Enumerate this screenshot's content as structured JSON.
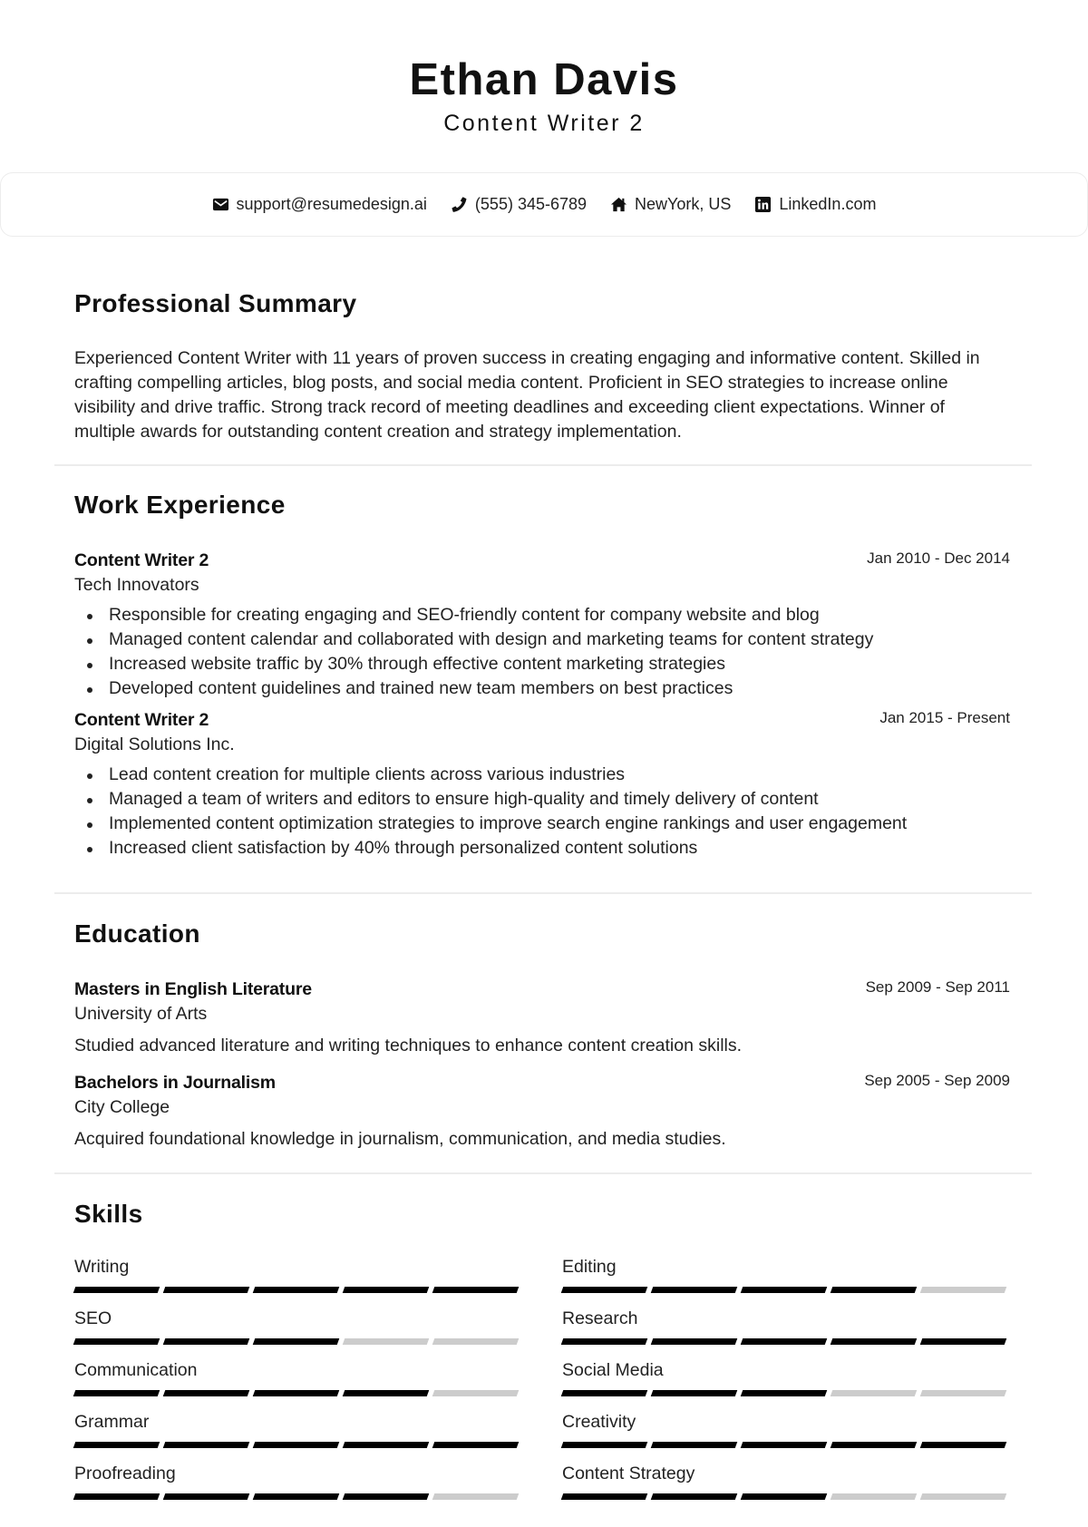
{
  "header": {
    "name": "Ethan Davis",
    "title": "Content Writer 2"
  },
  "contact": {
    "email": {
      "icon": "envelope-icon",
      "text": "support@resumedesign.ai"
    },
    "phone": {
      "icon": "phone-icon",
      "text": "(555) 345-6789"
    },
    "location": {
      "icon": "home-icon",
      "text": "NewYork, US"
    },
    "linkedin": {
      "icon": "linkedin-icon",
      "text": "LinkedIn.com"
    }
  },
  "summary": {
    "heading": "Professional Summary",
    "text": "Experienced Content Writer with 11 years of proven success in creating engaging and informative content. Skilled in crafting compelling articles, blog posts, and social media content. Proficient in SEO strategies to increase online visibility and drive traffic. Strong track record of meeting deadlines and exceeding client expectations. Winner of multiple awards for outstanding content creation and strategy implementation."
  },
  "experience": {
    "heading": "Work Experience",
    "jobs": [
      {
        "title": "Content Writer 2",
        "company": "Tech Innovators",
        "dates": "Jan 2010 - Dec 2014",
        "bullets": [
          "Responsible for creating engaging and SEO-friendly content for company website and blog",
          "Managed content calendar and collaborated with design and marketing teams for content strategy",
          "Increased website traffic by 30% through effective content marketing strategies",
          "Developed content guidelines and trained new team members on best practices"
        ]
      },
      {
        "title": "Content Writer 2",
        "company": "Digital Solutions Inc.",
        "dates": "Jan 2015 - Present",
        "bullets": [
          "Lead content creation for multiple clients across various industries",
          "Managed a team of writers and editors to ensure high-quality and timely delivery of content",
          "Implemented content optimization strategies to improve search engine rankings and user engagement",
          "Increased client satisfaction by 40% through personalized content solutions"
        ]
      }
    ]
  },
  "education": {
    "heading": "Education",
    "items": [
      {
        "degree": "Masters in English Literature",
        "school": "University of Arts",
        "dates": "Sep 2009 - Sep 2011",
        "description": "Studied advanced literature and writing techniques to enhance content creation skills."
      },
      {
        "degree": "Bachelors in Journalism",
        "school": "City College",
        "dates": "Sep 2005 - Sep 2009",
        "description": "Acquired foundational knowledge in journalism, communication, and media studies."
      }
    ]
  },
  "skills": {
    "heading": "Skills",
    "max_level": 5,
    "items": [
      {
        "name": "Writing",
        "level": 5
      },
      {
        "name": "Editing",
        "level": 4
      },
      {
        "name": "SEO",
        "level": 3
      },
      {
        "name": "Research",
        "level": 5
      },
      {
        "name": "Communication",
        "level": 4
      },
      {
        "name": "Social Media",
        "level": 3
      },
      {
        "name": "Grammar",
        "level": 5
      },
      {
        "name": "Creativity",
        "level": 5
      },
      {
        "name": "Proofreading",
        "level": 4
      },
      {
        "name": "Content Strategy",
        "level": 3
      }
    ],
    "colors": {
      "filled": "#000000",
      "empty": "#cccccc"
    }
  }
}
